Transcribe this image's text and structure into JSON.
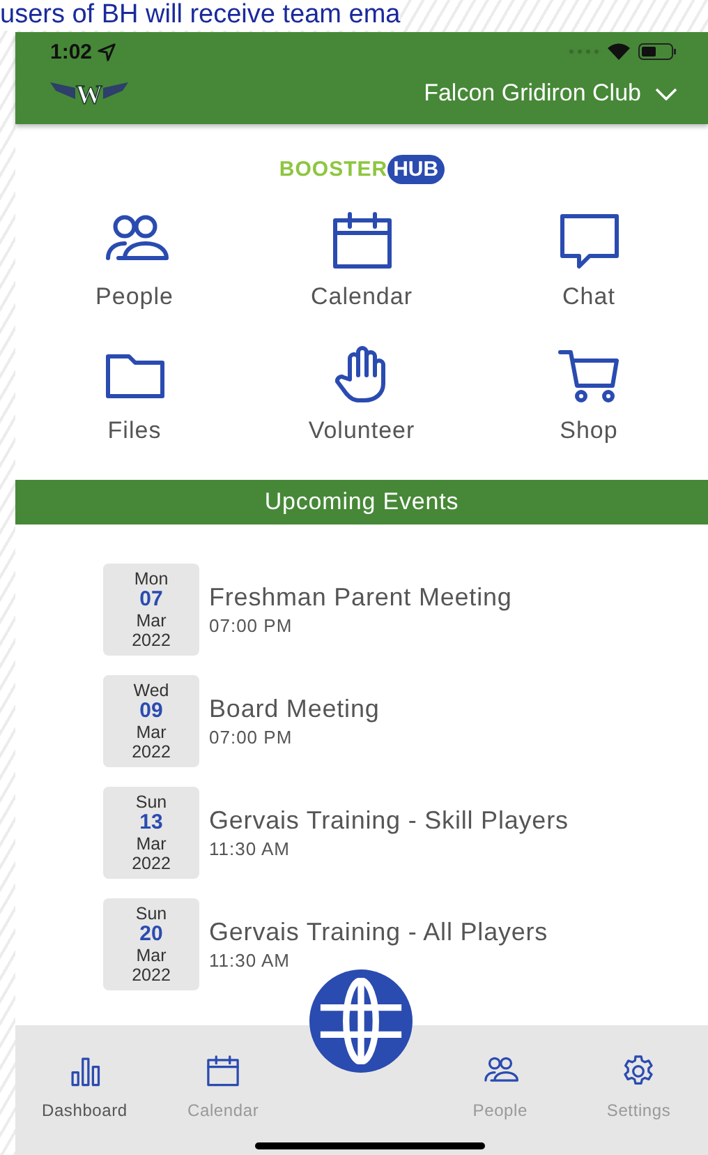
{
  "background_text": "users of BH will receive team ema",
  "status_bar": {
    "time": "1:02"
  },
  "header": {
    "team_logo": "W",
    "club_name": "Falcon Gridiron Club"
  },
  "brand_logo": {
    "left": "BOOSTER",
    "right": "HUB"
  },
  "shortcuts": [
    {
      "label": "People",
      "kind": "people"
    },
    {
      "label": "Calendar",
      "kind": "calendar"
    },
    {
      "label": "Chat",
      "kind": "chat"
    },
    {
      "label": "Files",
      "kind": "folder"
    },
    {
      "label": "Volunteer",
      "kind": "hand"
    },
    {
      "label": "Shop",
      "kind": "cart"
    }
  ],
  "events_title": "Upcoming Events",
  "events": [
    {
      "weekday": "Mon",
      "day": "07",
      "month": "Mar",
      "year": "2022",
      "title": "Freshman Parent Meeting",
      "time": "07:00 PM"
    },
    {
      "weekday": "Wed",
      "day": "09",
      "month": "Mar",
      "year": "2022",
      "title": "Board Meeting",
      "time": "07:00 PM"
    },
    {
      "weekday": "Sun",
      "day": "13",
      "month": "Mar",
      "year": "2022",
      "title": "Gervais Training - Skill Players",
      "time": "11:30 AM"
    },
    {
      "weekday": "Sun",
      "day": "20",
      "month": "Mar",
      "year": "2022",
      "title": "Gervais Training - All Players",
      "time": "11:30 AM"
    }
  ],
  "tab_bar": [
    {
      "label": "Dashboard",
      "kind": "bars",
      "selected": true
    },
    {
      "label": "Calendar",
      "kind": "calendar",
      "selected": false
    },
    {
      "kind": "globe"
    },
    {
      "label": "People",
      "kind": "people",
      "selected": false
    },
    {
      "label": "Settings",
      "kind": "gear",
      "selected": false
    }
  ]
}
